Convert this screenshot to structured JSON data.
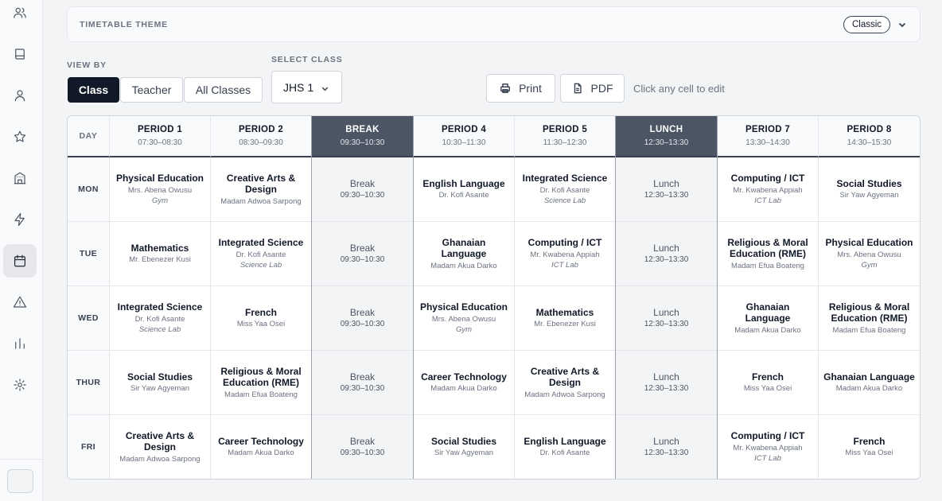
{
  "sidebar": {
    "icons": [
      "users-icon",
      "book-icon",
      "user-icon",
      "star-icon",
      "building-icon",
      "lightning-icon",
      "calendar-icon",
      "alert-icon",
      "bar-chart-icon",
      "gear-icon"
    ],
    "active": "calendar-icon"
  },
  "theme": {
    "label": "TIMETABLE THEME",
    "value": "Classic"
  },
  "view_by": {
    "label": "VIEW BY",
    "options": [
      "Class",
      "Teacher",
      "All Classes"
    ],
    "selected": "Class"
  },
  "select_class": {
    "label": "SELECT CLASS",
    "value": "JHS 1"
  },
  "actions": {
    "print": "Print",
    "pdf": "PDF",
    "hint": "Click any cell to edit"
  },
  "colors": {
    "primary": "#111827",
    "break_header": "#4b5563"
  },
  "timetable": {
    "day_header": "DAY",
    "headers": [
      {
        "title": "PERIOD 1",
        "time": "07:30–08:30"
      },
      {
        "title": "PERIOD 2",
        "time": "08:30–09:30"
      },
      {
        "title": "BREAK",
        "time": "09:30–10:30"
      },
      {
        "title": "PERIOD 4",
        "time": "10:30–11:30"
      },
      {
        "title": "PERIOD 5",
        "time": "11:30–12:30"
      },
      {
        "title": "LUNCH",
        "time": "12:30–13:30"
      },
      {
        "title": "PERIOD 7",
        "time": "13:30–14:30"
      },
      {
        "title": "PERIOD 8",
        "time": "14:30–15:30"
      }
    ],
    "rows": [
      {
        "day": "MON",
        "cells": [
          {
            "subject": "Physical Education",
            "teacher": "Mrs. Abena Owusu",
            "room": "Gym"
          },
          {
            "subject": "Creative Arts & Design",
            "teacher": "Madam Adwoa Sarpong",
            "room": ""
          },
          {
            "subject": "Break",
            "teacher": "09:30–10:30",
            "room": ""
          },
          {
            "subject": "English Language",
            "teacher": "Dr. Kofi Asante",
            "room": ""
          },
          {
            "subject": "Integrated Science",
            "teacher": "Dr. Kofi Asante",
            "room": "Science Lab"
          },
          {
            "subject": "Lunch",
            "teacher": "12:30–13:30",
            "room": ""
          },
          {
            "subject": "Computing / ICT",
            "teacher": "Mr. Kwabena Appiah",
            "room": "ICT Lab"
          },
          {
            "subject": "Social Studies",
            "teacher": "Sir Yaw Agyeman",
            "room": ""
          }
        ]
      },
      {
        "day": "TUE",
        "cells": [
          {
            "subject": "Mathematics",
            "teacher": "Mr. Ebenezer Kusi",
            "room": ""
          },
          {
            "subject": "Integrated Science",
            "teacher": "Dr. Kofi Asante",
            "room": "Science Lab"
          },
          {
            "subject": "Break",
            "teacher": "09:30–10:30",
            "room": ""
          },
          {
            "subject": "Ghanaian Language",
            "teacher": "Madam Akua Darko",
            "room": ""
          },
          {
            "subject": "Computing / ICT",
            "teacher": "Mr. Kwabena Appiah",
            "room": "ICT Lab"
          },
          {
            "subject": "Lunch",
            "teacher": "12:30–13:30",
            "room": ""
          },
          {
            "subject": "Religious & Moral Education (RME)",
            "teacher": "Madam Efua Boateng",
            "room": ""
          },
          {
            "subject": "Physical Education",
            "teacher": "Mrs. Abena Owusu",
            "room": "Gym"
          }
        ]
      },
      {
        "day": "WED",
        "cells": [
          {
            "subject": "Integrated Science",
            "teacher": "Dr. Kofi Asante",
            "room": "Science Lab"
          },
          {
            "subject": "French",
            "teacher": "Miss Yaa Osei",
            "room": ""
          },
          {
            "subject": "Break",
            "teacher": "09:30–10:30",
            "room": ""
          },
          {
            "subject": "Physical Education",
            "teacher": "Mrs. Abena Owusu",
            "room": "Gym"
          },
          {
            "subject": "Mathematics",
            "teacher": "Mr. Ebenezer Kusi",
            "room": ""
          },
          {
            "subject": "Lunch",
            "teacher": "12:30–13:30",
            "room": ""
          },
          {
            "subject": "Ghanaian Language",
            "teacher": "Madam Akua Darko",
            "room": ""
          },
          {
            "subject": "Religious & Moral Education (RME)",
            "teacher": "Madam Efua Boateng",
            "room": ""
          }
        ]
      },
      {
        "day": "THUR",
        "cells": [
          {
            "subject": "Social Studies",
            "teacher": "Sir Yaw Agyeman",
            "room": ""
          },
          {
            "subject": "Religious & Moral Education (RME)",
            "teacher": "Madam Efua Boateng",
            "room": ""
          },
          {
            "subject": "Break",
            "teacher": "09:30–10:30",
            "room": ""
          },
          {
            "subject": "Career Technology",
            "teacher": "Madam Akua Darko",
            "room": ""
          },
          {
            "subject": "Creative Arts & Design",
            "teacher": "Madam Adwoa Sarpong",
            "room": ""
          },
          {
            "subject": "Lunch",
            "teacher": "12:30–13:30",
            "room": ""
          },
          {
            "subject": "French",
            "teacher": "Miss Yaa Osei",
            "room": ""
          },
          {
            "subject": "Ghanaian Language",
            "teacher": "Madam Akua Darko",
            "room": ""
          }
        ]
      },
      {
        "day": "FRI",
        "cells": [
          {
            "subject": "Creative Arts & Design",
            "teacher": "Madam Adwoa Sarpong",
            "room": ""
          },
          {
            "subject": "Career Technology",
            "teacher": "Madam Akua Darko",
            "room": ""
          },
          {
            "subject": "Break",
            "teacher": "09:30–10:30",
            "room": ""
          },
          {
            "subject": "Social Studies",
            "teacher": "Sir Yaw Agyeman",
            "room": ""
          },
          {
            "subject": "English Language",
            "teacher": "Dr. Kofi Asante",
            "room": ""
          },
          {
            "subject": "Lunch",
            "teacher": "12:30–13:30",
            "room": ""
          },
          {
            "subject": "Computing / ICT",
            "teacher": "Mr. Kwabena Appiah",
            "room": "ICT Lab"
          },
          {
            "subject": "French",
            "teacher": "Miss Yaa Osei",
            "room": ""
          }
        ]
      }
    ]
  }
}
